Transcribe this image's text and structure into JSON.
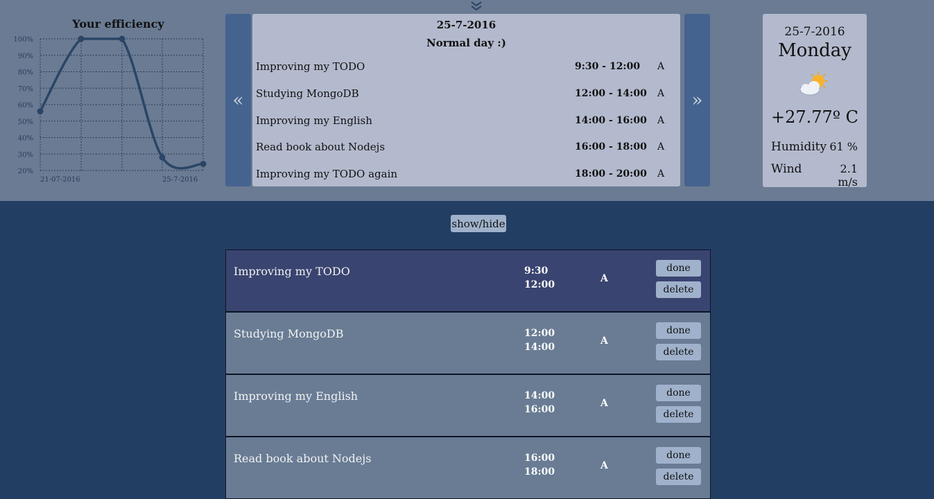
{
  "header": {
    "collapse_icon": "double-chevron-down-icon"
  },
  "chart_data": {
    "type": "line",
    "title": "Your efficiency",
    "x_tick_labels": [
      "21-07-2016",
      "25-7-2016"
    ],
    "y_tick_labels": [
      "100%",
      "90%",
      "80%",
      "70%",
      "60%",
      "50%",
      "40%",
      "30%",
      "20%"
    ],
    "ylim": [
      20,
      100
    ],
    "grid": true,
    "series": [
      {
        "values": [
          56,
          100,
          100,
          28,
          24
        ]
      }
    ],
    "color": "#2a4566"
  },
  "schedule": {
    "prev_label": "«",
    "next_label": "»",
    "date": "25-7-2016",
    "subtitle": "Normal day :)",
    "items": [
      {
        "name": "Improving my TODO",
        "time": "9:30 - 12:00",
        "priority": "A"
      },
      {
        "name": "Studying MongoDB",
        "time": "12:00 - 14:00",
        "priority": "A"
      },
      {
        "name": "Improving my English",
        "time": "14:00 - 16:00",
        "priority": "A"
      },
      {
        "name": "Read book about Nodejs",
        "time": "16:00 - 18:00",
        "priority": "A"
      },
      {
        "name": "Improving my TODO again",
        "time": "18:00 - 20:00",
        "priority": "A"
      }
    ]
  },
  "weather": {
    "date": "25-7-2016",
    "day": "Monday",
    "icon": "partly-cloudy-sun-icon",
    "temperature": "+27.77º C",
    "humidity_label": "Humidity",
    "humidity_value": "61 %",
    "wind_label": "Wind",
    "wind_value": "2.1 m/s"
  },
  "controls": {
    "show_hide_label": "show/hide"
  },
  "tasks": [
    {
      "name": "Improving my TODO",
      "start": "9:30",
      "end": "12:00",
      "priority": "A",
      "done_label": "done",
      "delete_label": "delete"
    },
    {
      "name": "Studying MongoDB",
      "start": "12:00",
      "end": "14:00",
      "priority": "A",
      "done_label": "done",
      "delete_label": "delete"
    },
    {
      "name": "Improving my English",
      "start": "14:00",
      "end": "16:00",
      "priority": "A",
      "done_label": "done",
      "delete_label": "delete"
    },
    {
      "name": "Read book about Nodejs",
      "start": "16:00",
      "end": "18:00",
      "priority": "A",
      "done_label": "done",
      "delete_label": "delete"
    }
  ]
}
